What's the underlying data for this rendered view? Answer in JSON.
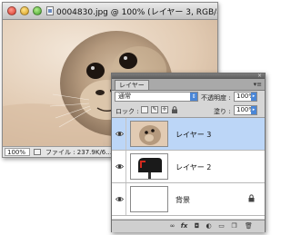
{
  "document": {
    "title": "0004830.jpg @ 100% (レイヤー 3, RGB/8...",
    "zoom": "100%",
    "file_info": "ファイル : 237.9K/6...",
    "icons": [
      "close-button",
      "minimize-button",
      "zoom-button",
      "document-icon",
      "status-menu-icon"
    ]
  },
  "layers_panel": {
    "tab_label": "レイヤー",
    "menu_icon": "panel-menu-icon",
    "blend_mode": "通常",
    "opacity_label": "不透明度 :",
    "opacity_value": "100%",
    "lock_label": "ロック :",
    "fill_label": "塗り :",
    "fill_value": "100%",
    "lock_icons": [
      "lock-transparency-icon",
      "lock-image-icon",
      "lock-position-icon",
      "lock-all-icon"
    ],
    "layers": [
      {
        "name": "レイヤー 3",
        "selected": true,
        "thumbnail": "seal-photo"
      },
      {
        "name": "レイヤー 2",
        "selected": false,
        "thumbnail": "mailbox"
      },
      {
        "name": "背景",
        "selected": false,
        "thumbnail": "white",
        "locked": true
      }
    ],
    "footer_buttons": [
      "link-layers-icon",
      "fx-icon",
      "add-mask-icon",
      "adjustment-layer-icon",
      "new-group-icon",
      "new-layer-icon",
      "trash-icon"
    ]
  },
  "colors": {
    "selection": "#bcd6f7",
    "accent": "#4a86d6"
  }
}
